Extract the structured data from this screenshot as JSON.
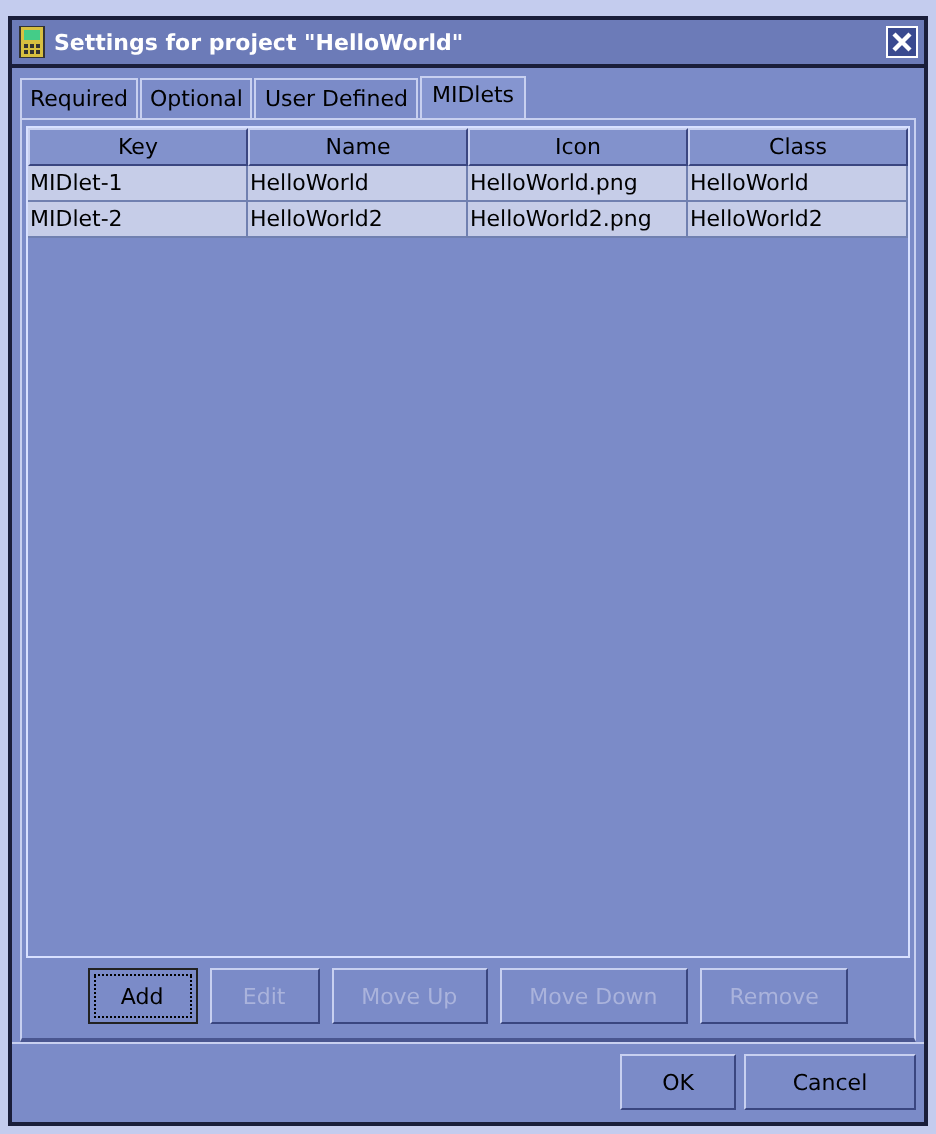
{
  "window": {
    "title": "Settings for project \"HelloWorld\""
  },
  "tabs": [
    {
      "label": "Required",
      "selected": false
    },
    {
      "label": "Optional",
      "selected": false
    },
    {
      "label": "User Defined",
      "selected": false
    },
    {
      "label": "MIDlets",
      "selected": true
    }
  ],
  "table": {
    "columns": [
      "Key",
      "Name",
      "Icon",
      "Class"
    ],
    "rows": [
      [
        "MIDlet-1",
        "HelloWorld",
        "HelloWorld.png",
        "HelloWorld"
      ],
      [
        "MIDlet-2",
        "HelloWorld2",
        "HelloWorld2.png",
        "HelloWorld2"
      ]
    ]
  },
  "actions": [
    {
      "label": "Add",
      "disabled": false,
      "focused": true
    },
    {
      "label": "Edit",
      "disabled": true,
      "focused": false
    },
    {
      "label": "Move Up",
      "disabled": true,
      "focused": false
    },
    {
      "label": "Move Down",
      "disabled": true,
      "focused": false
    },
    {
      "label": "Remove",
      "disabled": true,
      "focused": false
    }
  ],
  "buttons": [
    "OK",
    "Cancel"
  ]
}
